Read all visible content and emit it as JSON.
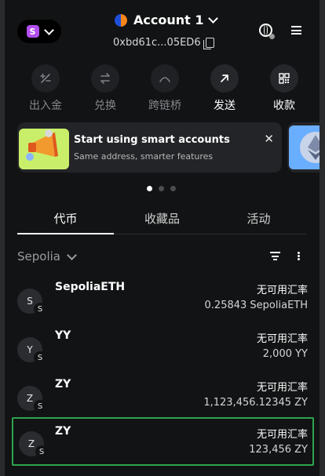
{
  "header": {
    "network_logo_letter": "S",
    "account_name": "Account 1",
    "address": "0xbd61c...05ED6"
  },
  "actions": [
    {
      "label": "出入金",
      "icon": "buy-sell-icon",
      "enabled": false
    },
    {
      "label": "兑换",
      "icon": "swap-icon",
      "enabled": false
    },
    {
      "label": "跨链桥",
      "icon": "bridge-icon",
      "enabled": false
    },
    {
      "label": "发送",
      "icon": "send-arrow-icon",
      "enabled": true
    },
    {
      "label": "收款",
      "icon": "qr-code-icon",
      "enabled": true
    }
  ],
  "banner": {
    "title": "Start using smart accounts",
    "subtitle": "Same address, smarter features",
    "close_glyph": "✕"
  },
  "carousel": {
    "total": 3,
    "active": 0
  },
  "tabs": [
    {
      "label": "代币",
      "active": true
    },
    {
      "label": "收藏品",
      "active": false
    },
    {
      "label": "活动",
      "active": false
    }
  ],
  "network_filter": {
    "label": "Sepolia"
  },
  "tokens": [
    {
      "avatar": "S",
      "badge": "S",
      "name": "SepoliaETH",
      "rate": "无可用汇率",
      "balance": "0.25843 SepoliaETH",
      "selected": false
    },
    {
      "avatar": "Y",
      "badge": "S",
      "name": "YY",
      "rate": "无可用汇率",
      "balance": "2,000 YY",
      "selected": false
    },
    {
      "avatar": "Z",
      "badge": "S",
      "name": "ZY",
      "rate": "无可用汇率",
      "balance": "1,123,456.12345 ZY",
      "selected": false
    },
    {
      "avatar": "Z",
      "badge": "S",
      "name": "ZY",
      "rate": "无可用汇率",
      "balance": "123,456 ZY",
      "selected": true
    }
  ],
  "colors": {
    "background": "#121314",
    "card": "#232427",
    "selected_border": "#2ea44f",
    "network_badge": "#b24ff0",
    "disabled_text": "#84878d"
  }
}
